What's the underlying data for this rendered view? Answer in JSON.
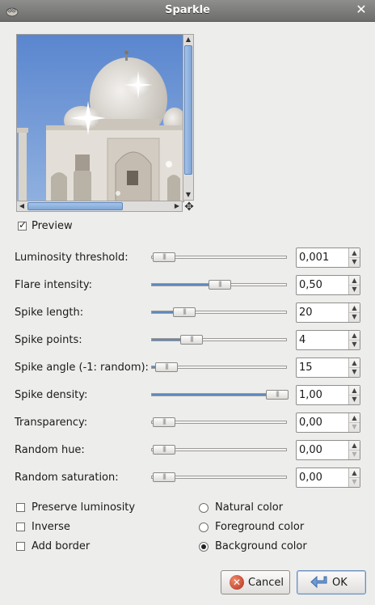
{
  "window": {
    "title": "Sparkle"
  },
  "preview": {
    "checkbox_label": "Preview",
    "checked": true
  },
  "sliders": [
    {
      "label": "Luminosity threshold:",
      "value": "0,001",
      "fraction": 0.09,
      "filled": false,
      "down_enabled": true
    },
    {
      "label": "Flare intensity:",
      "value": "0,50",
      "fraction": 0.5,
      "filled": true,
      "down_enabled": true
    },
    {
      "label": "Spike length:",
      "value": "20",
      "fraction": 0.24,
      "filled": true,
      "down_enabled": true
    },
    {
      "label": "Spike points:",
      "value": "4",
      "fraction": 0.29,
      "filled": true,
      "down_enabled": true
    },
    {
      "label": "Spike angle (-1: random):",
      "value": "15",
      "fraction": 0.11,
      "filled": true,
      "down_enabled": true
    },
    {
      "label": "Spike density:",
      "value": "1,00",
      "fraction": 0.92,
      "filled": true,
      "down_enabled": true
    },
    {
      "label": "Transparency:",
      "value": "0,00",
      "fraction": 0.09,
      "filled": false,
      "down_enabled": false
    },
    {
      "label": "Random hue:",
      "value": "0,00",
      "fraction": 0.09,
      "filled": false,
      "down_enabled": false
    },
    {
      "label": "Random saturation:",
      "value": "0,00",
      "fraction": 0.09,
      "filled": false,
      "down_enabled": false
    }
  ],
  "options": {
    "checkboxes": [
      {
        "label": "Preserve luminosity",
        "checked": false
      },
      {
        "label": "Inverse",
        "checked": false
      },
      {
        "label": "Add border",
        "checked": false
      }
    ],
    "radios": [
      {
        "label": "Natural color",
        "selected": false
      },
      {
        "label": "Foreground color",
        "selected": false
      },
      {
        "label": "Background color",
        "selected": true
      }
    ]
  },
  "buttons": {
    "cancel": "Cancel",
    "ok": "OK"
  },
  "colors": {
    "accent": "#5e88bd",
    "titlebar": "#7b7b79"
  }
}
